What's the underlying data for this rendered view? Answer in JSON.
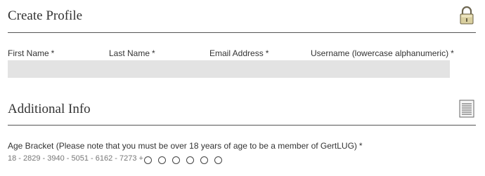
{
  "create_profile": {
    "title": "Create Profile",
    "icon": "lock-icon",
    "fields": [
      {
        "label": "First Name",
        "required": "*",
        "value": "",
        "placeholder": ""
      },
      {
        "label": "Last Name",
        "required": "*",
        "value": "",
        "placeholder": ""
      },
      {
        "label": "Email Address",
        "required": "*",
        "value": "",
        "placeholder": ""
      },
      {
        "label": "Username (lowercase alphanumeric)",
        "required": "*",
        "value": "",
        "placeholder": ""
      }
    ]
  },
  "additional_info": {
    "title": "Additional Info",
    "icon": "document-icon",
    "age_bracket": {
      "label": "Age Bracket (Please note that you must be over 18 years of age to be a member of GertLUG)",
      "required": "*",
      "options_text": "18 - 2829 - 3940 - 5051 - 6162 - 7273 +",
      "options": [
        "18 - 28",
        "29 - 39",
        "40 - 50",
        "51 - 61",
        "62 - 72",
        "73 +"
      ]
    }
  },
  "colors": {
    "field_background": "#e3e3e3",
    "divider": "#555555",
    "text": "#333333",
    "muted_text": "#777777"
  }
}
